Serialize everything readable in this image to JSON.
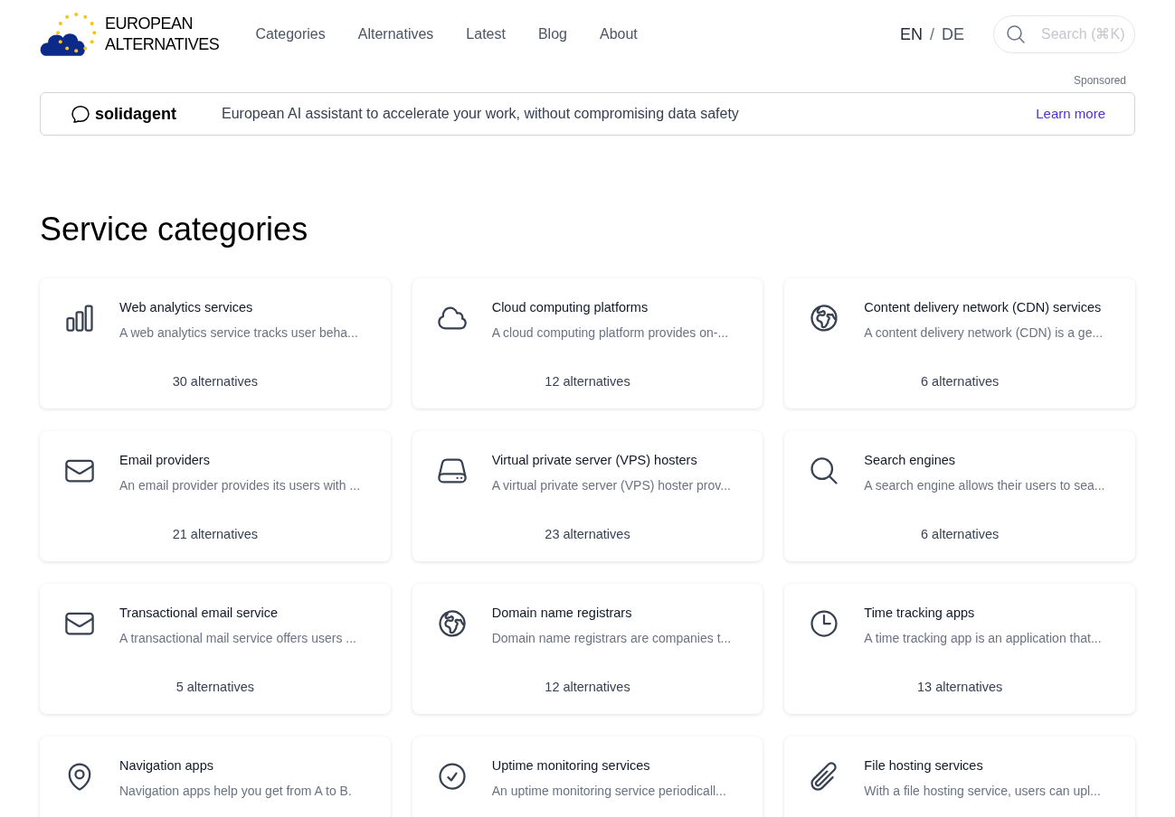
{
  "logo": {
    "text": "EUROPEAN ALTERNATIVES"
  },
  "nav": [
    "Categories",
    "Alternatives",
    "Latest",
    "Blog",
    "About"
  ],
  "languages": [
    {
      "label": "EN",
      "selected": true
    },
    {
      "label": "DE",
      "selected": false
    }
  ],
  "language_separator": "/",
  "search": {
    "placeholder": "Search (⌘K)"
  },
  "sponsor": {
    "label": "Sponsored",
    "brand": "solidagent",
    "text": "European AI assistant to accelerate your work, without compromising data safety",
    "link": "Learn more"
  },
  "heading": "Service categories",
  "categories": [
    {
      "kind": "chart",
      "title": "Web analytics services",
      "description": "A web analytics service tracks user beha...",
      "count": "30 alternatives"
    },
    {
      "kind": "cloud",
      "title": "Cloud computing platforms",
      "description": "A cloud computing platform provides on-...",
      "count": "12 alternatives"
    },
    {
      "kind": "globe",
      "title": "Content delivery network (CDN) services",
      "description": "A content delivery network (CDN) is a ge...",
      "count": "6 alternatives"
    },
    {
      "kind": "mail",
      "title": "Email providers",
      "description": "An email provider provides its users with ...",
      "count": "21 alternatives"
    },
    {
      "kind": "server",
      "title": "Virtual private server (VPS) hosters",
      "description": "A virtual private server (VPS) hoster prov...",
      "count": "23 alternatives"
    },
    {
      "kind": "search",
      "title": "Search engines",
      "description": "A search engine allows their users to sea...",
      "count": "6 alternatives"
    },
    {
      "kind": "mail",
      "title": "Transactional email service",
      "description": "A transactional mail service offers users ...",
      "count": "5 alternatives"
    },
    {
      "kind": "globe",
      "title": "Domain name registrars",
      "description": "Domain name registrars are companies t...",
      "count": "12 alternatives"
    },
    {
      "kind": "clock",
      "title": "Time tracking apps",
      "description": "A time tracking app is an application that...",
      "count": "13 alternatives"
    },
    {
      "kind": "pin",
      "title": "Navigation apps",
      "description": "Navigation apps help you get from A to B."
    },
    {
      "kind": "check",
      "title": "Uptime monitoring services",
      "description": "An uptime monitoring service periodicall..."
    },
    {
      "kind": "clip",
      "title": "File hosting services",
      "description": "With a file hosting service, users can upl..."
    }
  ]
}
